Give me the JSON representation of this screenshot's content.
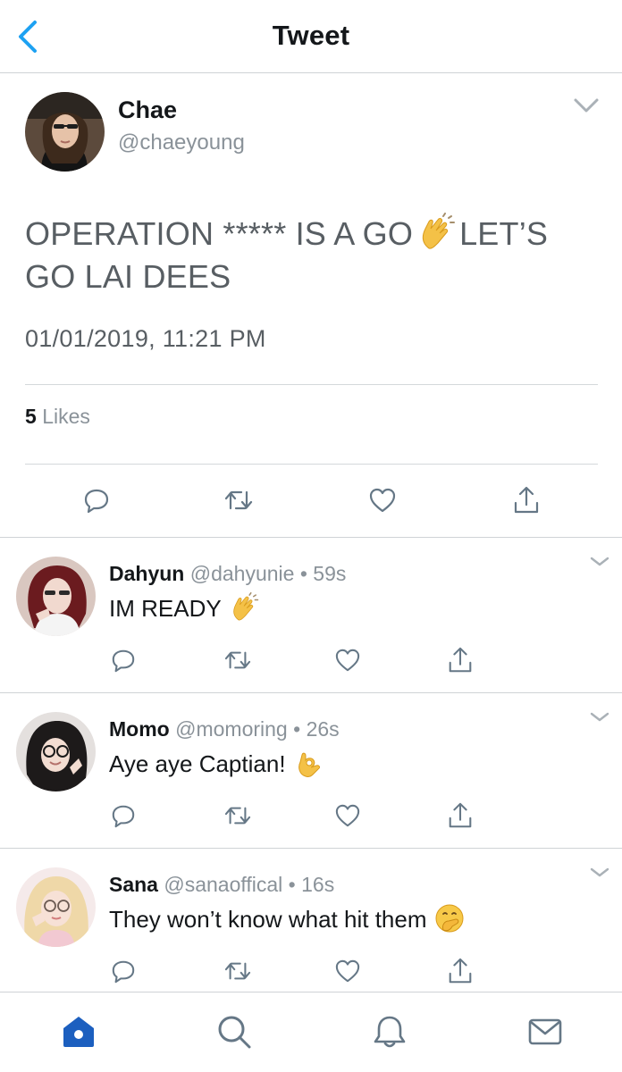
{
  "header": {
    "title": "Tweet"
  },
  "tweet": {
    "name": "Chae",
    "handle": "@chaeyoung",
    "text_part1": "OPERATION ***** IS A GO",
    "text_part2": "LET’S GO LAI DEES",
    "text_emoji": "clapping-hands-emoji",
    "timestamp": "01/01/2019, 11:21 PM",
    "likes_count": "5",
    "likes_label": "Likes"
  },
  "replies": [
    {
      "name": "Dahyun",
      "handle": "@dahyunie",
      "dot": "•",
      "time": "59s",
      "text": "IM READY",
      "emoji": "clapping-hands-emoji"
    },
    {
      "name": "Momo",
      "handle": "@momoring",
      "dot": "•",
      "time": "26s",
      "text": "Aye aye Captian!",
      "emoji": "ok-hand-emoji"
    },
    {
      "name": "Sana",
      "handle": "@sanaoffical",
      "dot": "•",
      "time": "16s",
      "text": "They won’t know what hit them",
      "emoji": "face-with-hand-over-mouth-emoji"
    }
  ],
  "tabbar": {
    "items": [
      "home-icon",
      "search-icon",
      "notifications-icon",
      "messages-icon"
    ],
    "active": "home-icon"
  },
  "colors": {
    "accent": "#1da1f2",
    "home_active": "#1c5fbf",
    "text_primary": "#14171a",
    "text_secondary": "#8a9299",
    "tweet_body": "#585e63",
    "divider": "#cfd3d6"
  }
}
